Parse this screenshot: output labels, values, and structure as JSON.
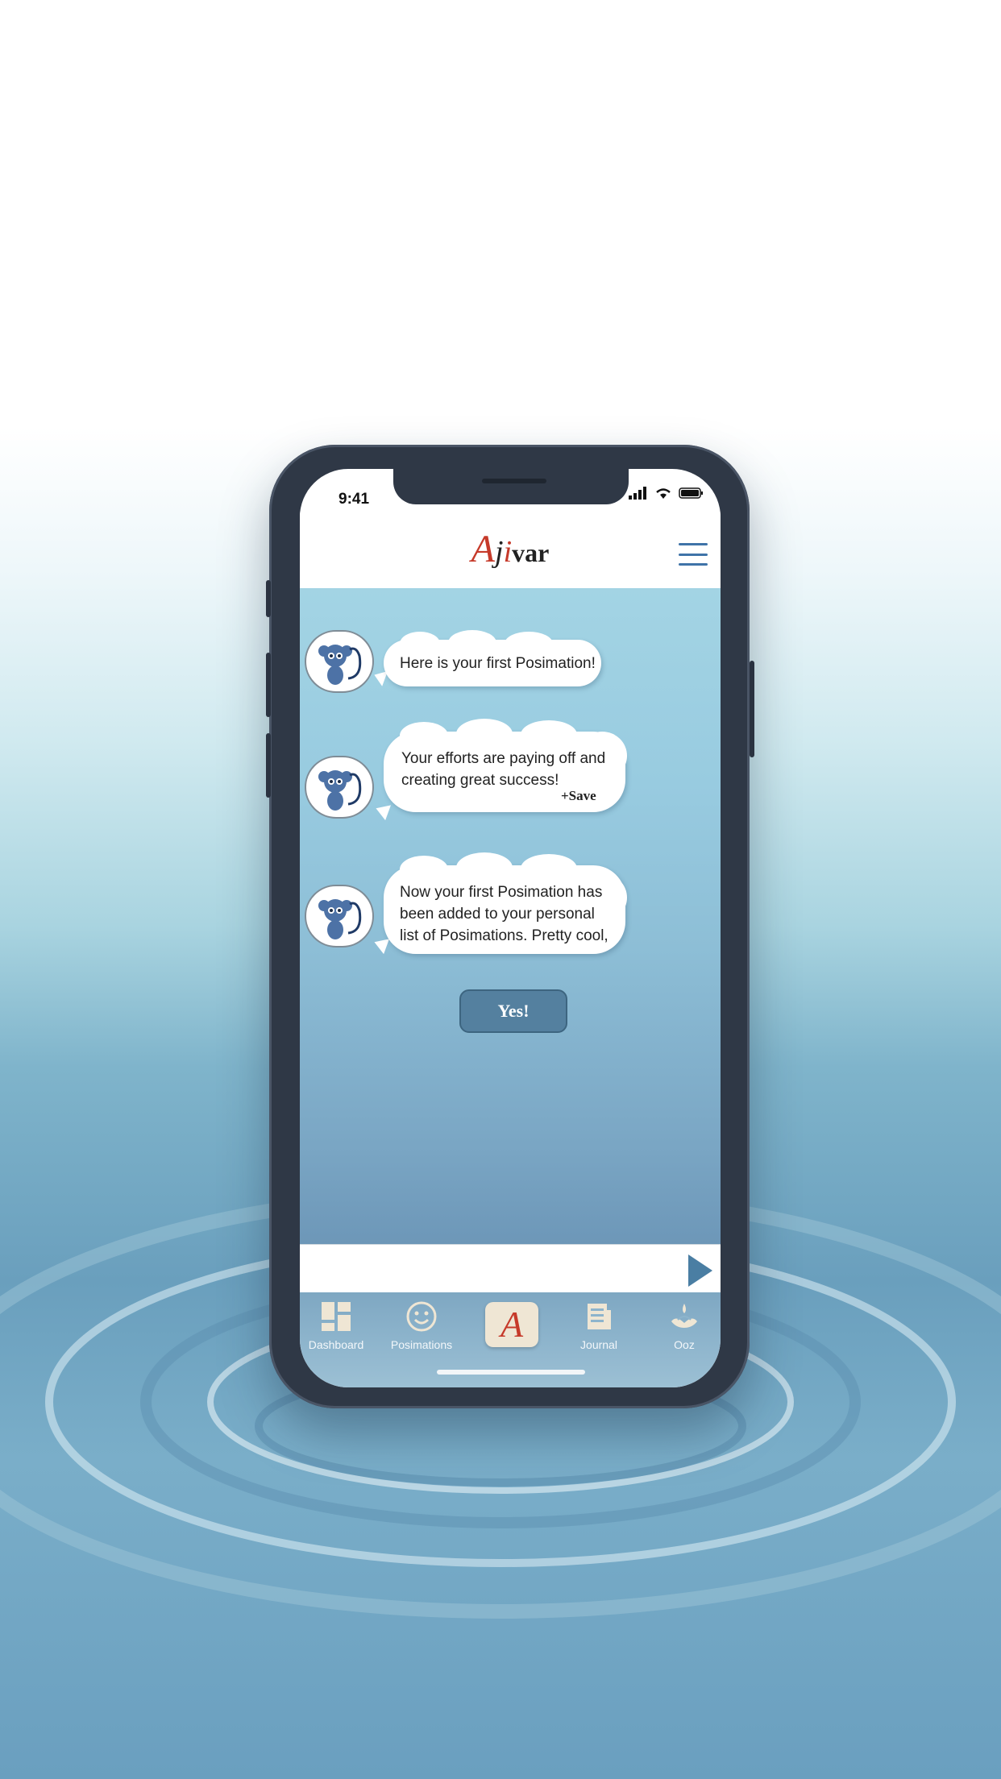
{
  "status_bar": {
    "time": "9:41"
  },
  "header": {
    "logo": {
      "a": "A",
      "j": "j",
      "i": "i",
      "var": "var"
    },
    "menu_icon": "hamburger-menu-icon"
  },
  "chat": {
    "messages": [
      {
        "text": "Here is your first Posimation!"
      },
      {
        "line1": "Your efforts are paying off and",
        "line2": "creating great success!",
        "save_label": "+Save"
      },
      {
        "line1": "Now your first Posimation has",
        "line2": "been added to your personal",
        "line3": "list of Posimations. Pretty cool,"
      }
    ],
    "yes_button": "Yes!"
  },
  "tabbar": {
    "tabs": [
      {
        "label": "Dashboard",
        "icon": "dashboard-icon"
      },
      {
        "label": "Posimations",
        "icon": "smiley-icon"
      },
      {
        "label": "",
        "icon": "ajivar-logo-icon",
        "glyph": "A"
      },
      {
        "label": "Journal",
        "icon": "journal-icon"
      },
      {
        "label": "Ooz",
        "icon": "lotus-icon"
      }
    ]
  },
  "colors": {
    "accent_red": "#c63a2a",
    "accent_blue": "#3f73a8",
    "button_blue": "#54809f"
  }
}
